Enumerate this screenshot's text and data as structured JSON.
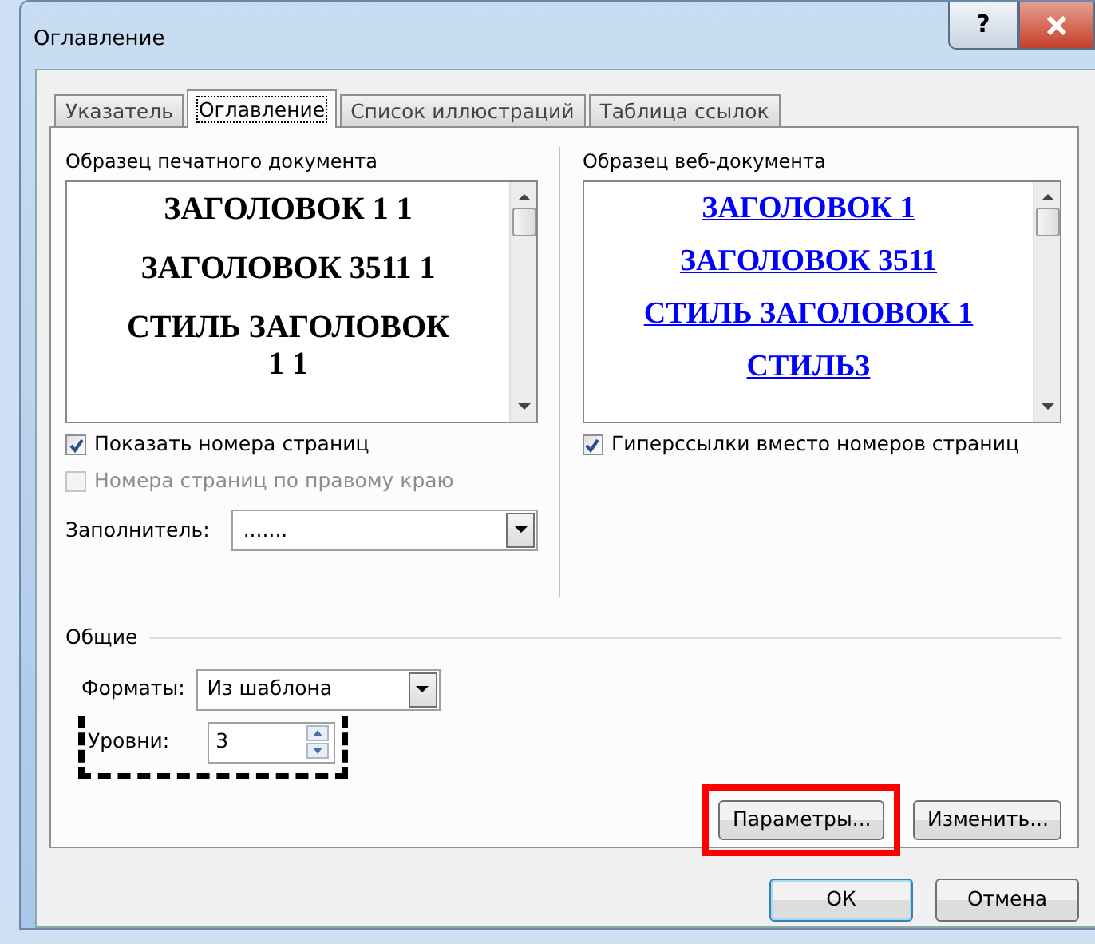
{
  "window": {
    "title": "Оглавление",
    "help": "?"
  },
  "tabs": [
    {
      "label": "Указатель",
      "selected": false
    },
    {
      "label": "Оглавление",
      "selected": true
    },
    {
      "label": "Список иллюстраций",
      "selected": false
    },
    {
      "label": "Таблица ссылок",
      "selected": false
    }
  ],
  "print_preview": {
    "label": "Образец печатного документа",
    "lines": [
      "ЗАГОЛОВОК 1 1",
      "ЗАГОЛОВОК 3511 1",
      "СТИЛЬ ЗАГОЛОВОК 1 1"
    ]
  },
  "print_options": [
    {
      "label": "Показать номера страниц",
      "checked": true,
      "disabled": false
    },
    {
      "label": "Номера страниц по правому краю",
      "checked": false,
      "disabled": true
    }
  ],
  "leader": {
    "label": "Заполнитель:",
    "value": "......."
  },
  "web_preview": {
    "label": "Образец веб-документа",
    "lines": [
      "ЗАГОЛОВОК 1",
      "ЗАГОЛОВОК 3511",
      "СТИЛЬ ЗАГОЛОВОК 1",
      "СТИЛЬ3"
    ]
  },
  "web_options": [
    {
      "label": "Гиперссылки вместо номеров страниц",
      "checked": true,
      "disabled": false
    }
  ],
  "general": {
    "title": "Общие",
    "formats": {
      "label": "Форматы:",
      "value": "Из шаблона"
    },
    "levels": {
      "label": "Уровни:",
      "value": "3",
      "annotated": true
    }
  },
  "actions": [
    {
      "label": "Параметры...",
      "annotated": true
    },
    {
      "label": "Изменить...",
      "annotated": false
    }
  ],
  "buttons": [
    {
      "label": "ОК",
      "default": true
    },
    {
      "label": "Отмена",
      "default": false
    }
  ]
}
